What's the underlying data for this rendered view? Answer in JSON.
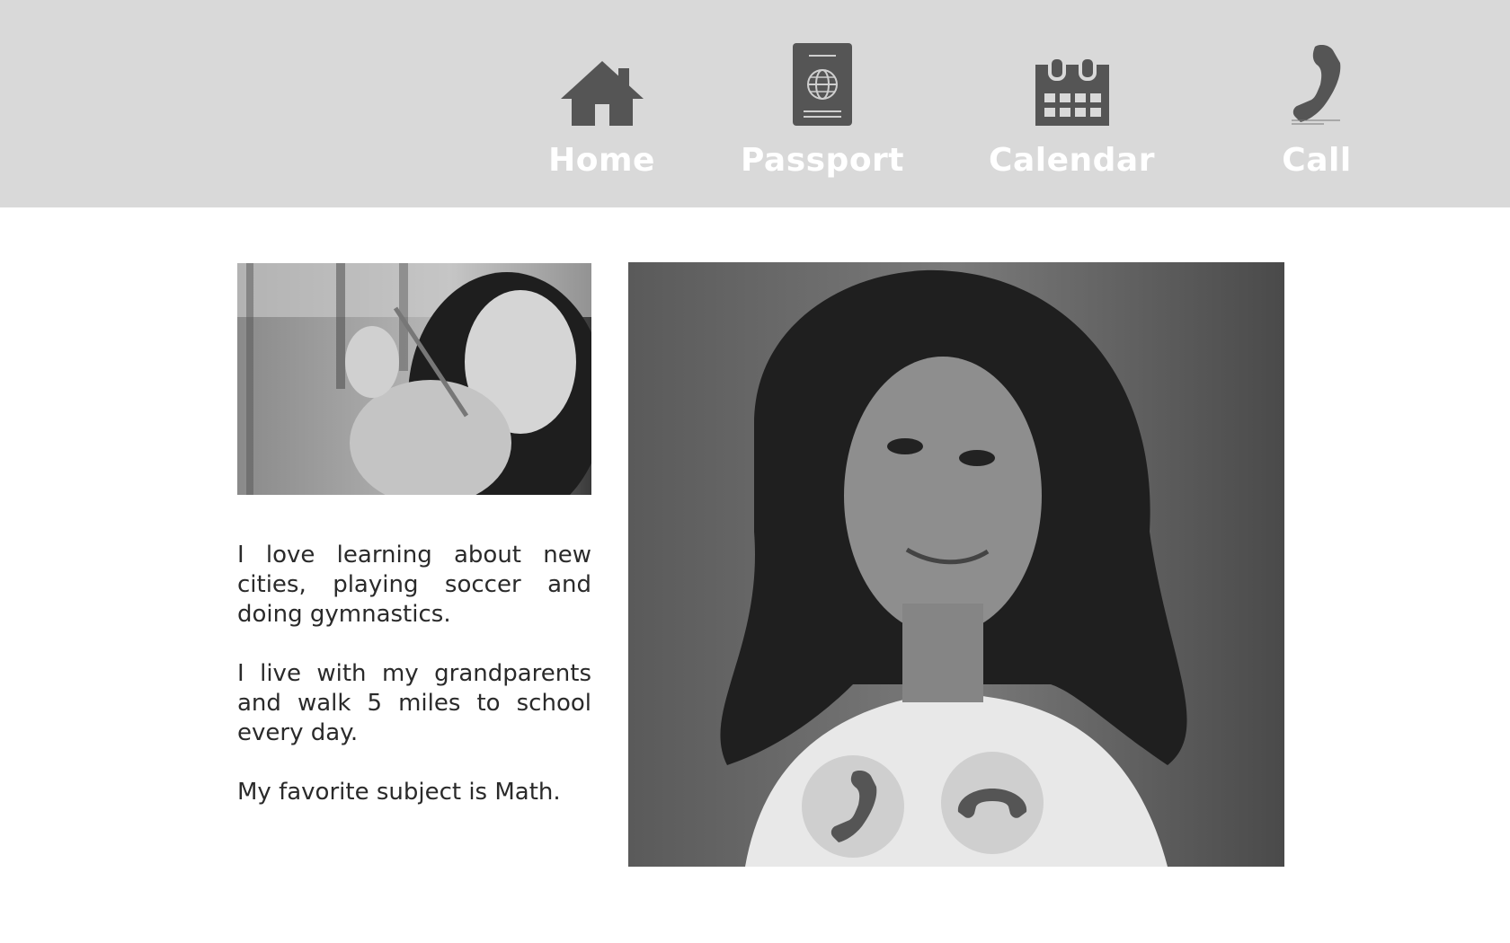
{
  "nav": {
    "items": [
      {
        "label": "Home",
        "icon": "home-icon"
      },
      {
        "label": "Passport",
        "icon": "passport-icon"
      },
      {
        "label": "Calendar",
        "icon": "calendar-icon"
      },
      {
        "label": "Call",
        "icon": "phone-icon"
      }
    ]
  },
  "profile": {
    "photo": "girl-with-pencil-photo",
    "bio": [
      "I love learning about new cities, playing soccer and doing gymnastics.",
      "I live with my grandparents and walk 5 miles to school every day.",
      "My favorite subject is Math."
    ]
  },
  "video_call": {
    "feed": "video-call-feed",
    "answer_icon": "phone-answer-icon",
    "hangup_icon": "phone-hangup-icon"
  },
  "colors": {
    "topbar": "#d9d9d9",
    "icon": "#555555",
    "nav_text": "#ffffff",
    "body_text": "#2a2a2a",
    "call_button": "#cfcfcf"
  }
}
